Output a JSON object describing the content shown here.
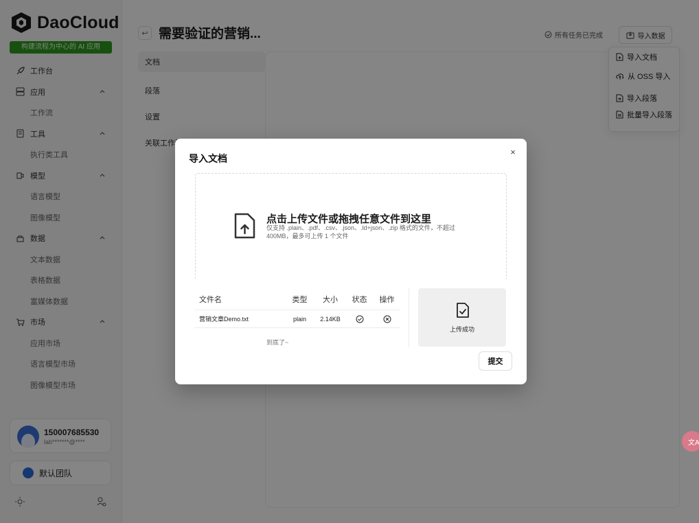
{
  "brand": {
    "name": "DaoCloud",
    "tagline": "构建流程为中心的 AI 应用",
    "accent": "#2f9a1f"
  },
  "sidebar": {
    "items": [
      {
        "label": "工作台",
        "icon": "rocket-icon",
        "sub": false
      },
      {
        "label": "应用",
        "icon": "apps-icon",
        "sub": false,
        "caret": true
      },
      {
        "label": "工作流",
        "sub": true
      },
      {
        "label": "工具",
        "icon": "tool-icon",
        "sub": false,
        "caret": true
      },
      {
        "label": "执行类工具",
        "sub": true
      },
      {
        "label": "模型",
        "icon": "model-icon",
        "sub": false,
        "caret": true
      },
      {
        "label": "语言模型",
        "sub": true
      },
      {
        "label": "图像模型",
        "sub": true
      },
      {
        "label": "数据",
        "icon": "database-icon",
        "sub": false,
        "caret": true
      },
      {
        "label": "文本数据",
        "sub": true
      },
      {
        "label": "表格数据",
        "sub": true
      },
      {
        "label": "富媒体数据",
        "sub": true
      },
      {
        "label": "市场",
        "icon": "cart-icon",
        "sub": false,
        "caret": true
      },
      {
        "label": "应用市场",
        "sub": true
      },
      {
        "label": "语言模型市场",
        "sub": true
      },
      {
        "label": "图像模型市场",
        "sub": true
      }
    ],
    "user": {
      "name": "150007685530",
      "email": "lab*******@****"
    },
    "team": {
      "label": "默认团队"
    }
  },
  "header": {
    "back": "↩",
    "title": "需要验证的营销...",
    "tasks_status": "所有任务已完成",
    "import_label": "导入数据"
  },
  "tabs": [
    "文档",
    "段落",
    "设置",
    "关联工作流"
  ],
  "import_menu": {
    "items": [
      {
        "label": "导入文档",
        "icon": "file-plus-icon"
      },
      {
        "label": "从 OSS 导入",
        "icon": "cloud-upload-icon"
      },
      {
        "label": "导入段落",
        "icon": "file-import-icon"
      },
      {
        "label": "批量导入段落",
        "icon": "file-batch-icon"
      }
    ]
  },
  "modal": {
    "title": "导入文档",
    "close": "×",
    "upload": {
      "main": "点击上传文件或拖拽任意文件到这里",
      "hint": "仅支持 .plain、.pdf、.csv、.json、.ld+json、.zip 格式的文件，不超过 400MB，最多可上传 1 个文件"
    },
    "table": {
      "headers": {
        "name": "文件名",
        "type": "类型",
        "size": "大小",
        "state": "状态",
        "op": "操作"
      },
      "rows": [
        {
          "name": "营销文章Demo.txt",
          "type": "plain",
          "size": "2.14KB",
          "state": "check-circle-icon",
          "op": "close-circle-icon"
        }
      ],
      "end": "到底了~"
    },
    "success": "上传成功",
    "submit": "提交"
  },
  "float_button": "文A"
}
